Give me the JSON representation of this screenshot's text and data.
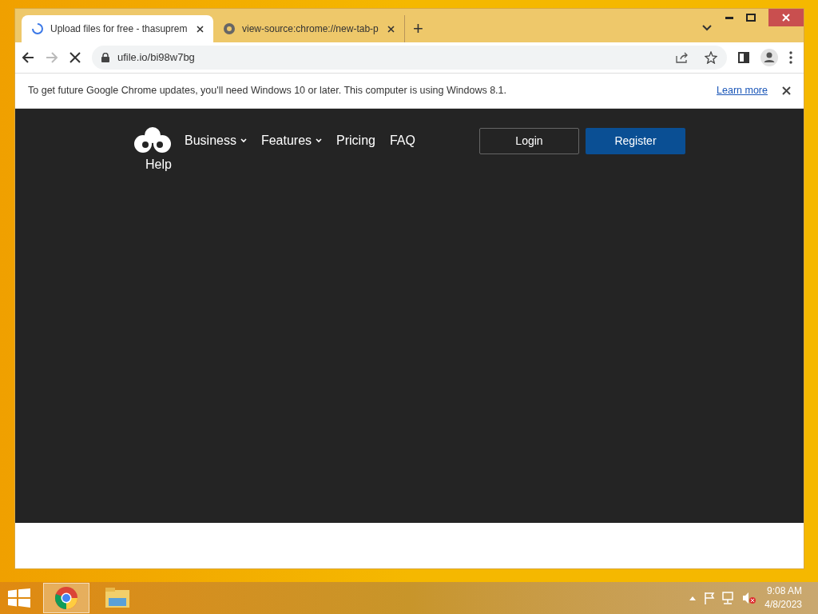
{
  "tabs": [
    {
      "title": "Upload files for free - thasuprem",
      "selected": true,
      "kind": "loading"
    },
    {
      "title": "view-source:chrome://new-tab-p",
      "selected": false,
      "kind": "chrome"
    }
  ],
  "new_tab": "+",
  "address": {
    "url": "ufile.io/bi98w7bg",
    "loading": true
  },
  "infobar": {
    "message": "To get future Google Chrome updates, you'll need Windows 10 or later. This computer is using Windows 8.1.",
    "link": "Learn more"
  },
  "site_nav": {
    "items": [
      {
        "label": "Business",
        "dropdown": true
      },
      {
        "label": "Features",
        "dropdown": true
      },
      {
        "label": "Pricing",
        "dropdown": false
      },
      {
        "label": "FAQ",
        "dropdown": false
      }
    ],
    "help": "Help",
    "login": "Login",
    "register": "Register"
  },
  "taskbar": {
    "apps": [
      {
        "kind": "chrome",
        "selected": true
      },
      {
        "kind": "explorer",
        "selected": false
      }
    ],
    "time": "9:08 AM",
    "date": "4/8/2023"
  }
}
